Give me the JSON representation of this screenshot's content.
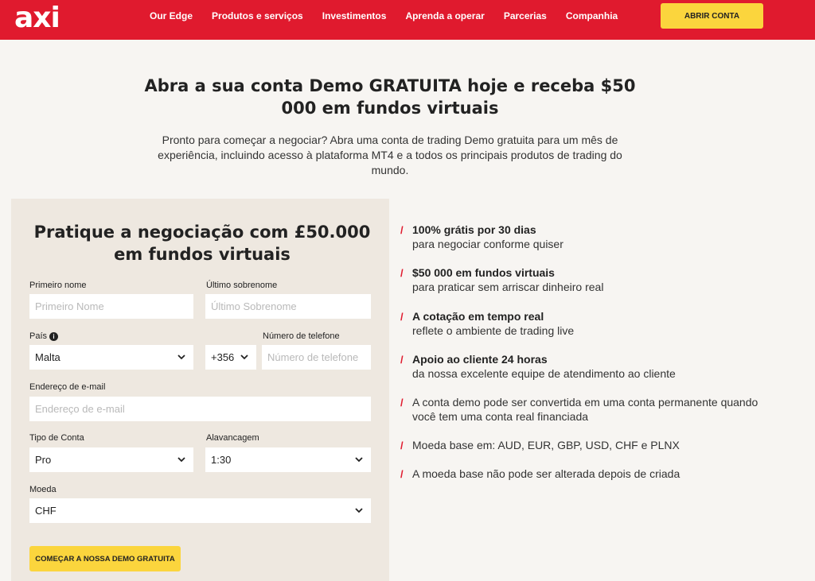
{
  "header": {
    "logo": "axi",
    "nav": [
      "Our Edge",
      "Produtos e serviços",
      "Investimentos",
      "Aprenda a operar",
      "Parcerias",
      "Companhia"
    ],
    "cta": "ABRIR CONTA",
    "background_color": "#e01a2e",
    "cta_color": "#fbd53d"
  },
  "hero": {
    "title": "Abra a sua conta Demo GRATUITA hoje e receba $50 000 em fundos virtuais",
    "subtitle": "Pronto para começar a negociar? Abra uma conta de trading Demo gratuita para um mês de experiência, incluindo acesso à plataforma MT4 e a todos os principais produtos de trading do mundo."
  },
  "form": {
    "title": "Pratique a negociação com £50.000 em fundos virtuais",
    "first_name": {
      "label": "Primeiro nome",
      "placeholder": "Primeiro Nome"
    },
    "last_name": {
      "label": "Último sobrenome",
      "placeholder": "Último Sobrenome"
    },
    "country": {
      "label": "País",
      "value": "Malta"
    },
    "phone_code": {
      "value": "+356"
    },
    "phone": {
      "label": "Número de telefone",
      "placeholder": "Número de telefone"
    },
    "email": {
      "label": "Endereço de e-mail",
      "placeholder": "Endereço de e-mail"
    },
    "account_type": {
      "label": "Tipo de Conta",
      "value": "Pro"
    },
    "leverage": {
      "label": "Alavancagem",
      "value": "1:30"
    },
    "currency": {
      "label": "Moeda",
      "value": "CHF"
    },
    "submit": "COMEÇAR A NOSSA DEMO GRATUITA",
    "panel_color": "#eee8e0"
  },
  "features": [
    {
      "bold": "100% grátis por 30 dias",
      "text": "para negociar conforme quiser"
    },
    {
      "bold": "$50 000 em fundos virtuais",
      "text": "para praticar sem arriscar dinheiro real"
    },
    {
      "bold": "A cotação em tempo real",
      "text": "reflete o ambiente de trading live"
    },
    {
      "bold": "Apoio ao cliente 24 horas",
      "text": "da nossa excelente equipe de atendimento ao cliente"
    },
    {
      "bold": "",
      "text": "A conta demo pode ser convertida em uma conta permanente quando você tem uma conta real financiada"
    },
    {
      "bold": "",
      "text": "Moeda base em: AUD, EUR, GBP, USD, CHF e PLNX"
    },
    {
      "bold": "",
      "text": "A moeda base não pode ser alterada depois de criada"
    }
  ]
}
